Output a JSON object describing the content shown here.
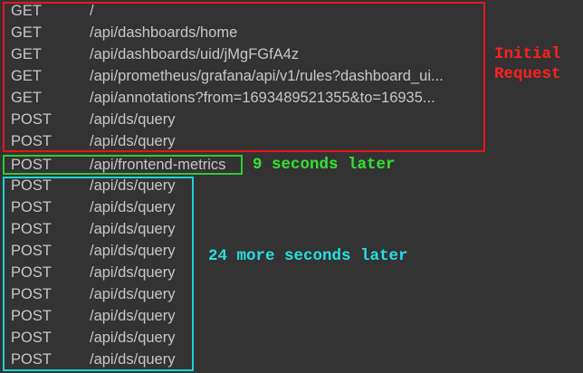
{
  "requests": [
    {
      "method": "GET",
      "path": "/"
    },
    {
      "method": "GET",
      "path": "/api/dashboards/home"
    },
    {
      "method": "GET",
      "path": "/api/dashboards/uid/jMgFGfA4z"
    },
    {
      "method": "GET",
      "path": "/api/prometheus/grafana/api/v1/rules?dashboard_ui..."
    },
    {
      "method": "GET",
      "path": "/api/annotations?from=1693489521355&to=16935..."
    },
    {
      "method": "POST",
      "path": "/api/ds/query"
    },
    {
      "method": "POST",
      "path": "/api/ds/query"
    },
    {
      "method": "POST",
      "path": "/api/frontend-metrics"
    },
    {
      "method": "POST",
      "path": "/api/ds/query"
    },
    {
      "method": "POST",
      "path": "/api/ds/query"
    },
    {
      "method": "POST",
      "path": "/api/ds/query"
    },
    {
      "method": "POST",
      "path": "/api/ds/query"
    },
    {
      "method": "POST",
      "path": "/api/ds/query"
    },
    {
      "method": "POST",
      "path": "/api/ds/query"
    },
    {
      "method": "POST",
      "path": "/api/ds/query"
    },
    {
      "method": "POST",
      "path": "/api/ds/query"
    },
    {
      "method": "POST",
      "path": "/api/ds/query"
    }
  ],
  "annotations": {
    "initial_line1": "Initial",
    "initial_line2": "Request",
    "nine_seconds": "9 seconds later",
    "more_seconds": "24 more seconds later"
  },
  "colors": {
    "background": "#333333",
    "text": "#c7c7c7",
    "initial": "#e8161a",
    "nine_seconds": "#2fcc2f",
    "more_seconds": "#1ed3d8"
  }
}
